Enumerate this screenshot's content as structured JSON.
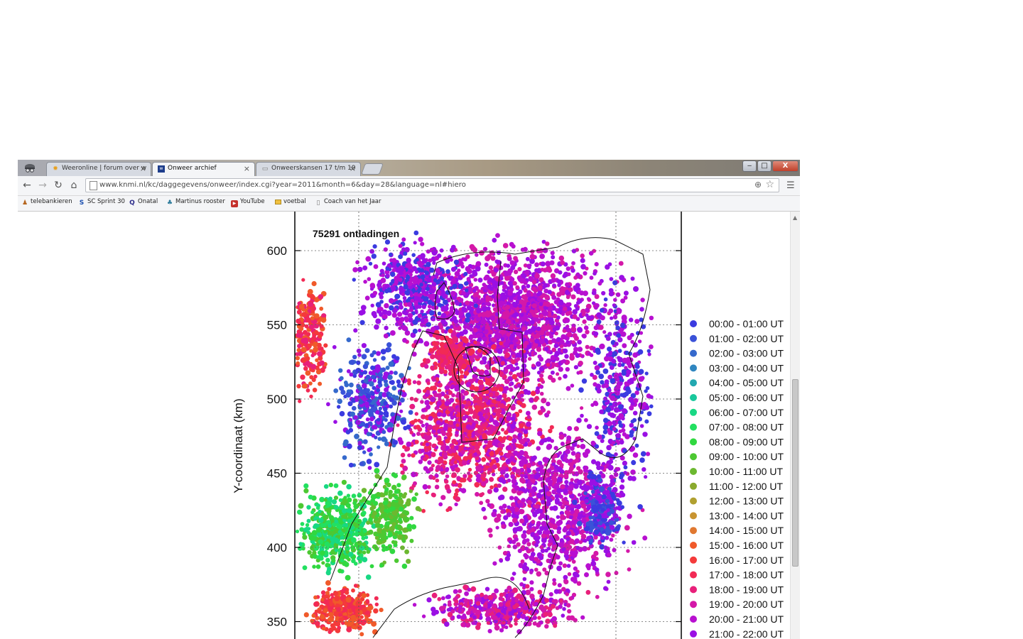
{
  "browser": {
    "tabs": [
      {
        "title": "Weeronline | forum over w",
        "icon": "forum-icon"
      },
      {
        "title": "Onweer archief",
        "icon": "knmi-icon"
      },
      {
        "title": "Onweerskansen 17 t/m 19",
        "icon": "page-icon"
      }
    ],
    "url": "www.knmi.nl/kc/daggegevens/onweer/index.cgi?year=2011&month=6&day=28&language=nl#hiero",
    "bookmarks": [
      {
        "label": "telebankieren",
        "icon": "bank-icon"
      },
      {
        "label": "SC Sprint 30",
        "icon": "sc-icon"
      },
      {
        "label": "Onatal",
        "icon": "q-icon"
      },
      {
        "label": "Martinus rooster",
        "icon": "tree-icon"
      },
      {
        "label": "YouTube",
        "icon": "youtube-icon"
      },
      {
        "label": "voetbal",
        "icon": "folder-icon"
      },
      {
        "label": "Coach van het Jaar",
        "icon": "page-icon"
      }
    ],
    "window_buttons": {
      "minimize": "‒",
      "maximize": "□",
      "close": "X"
    }
  },
  "chart_data": {
    "type": "scatter",
    "title": "75291 ontladingen",
    "ylabel": "Y-coordinaat (km)",
    "yticks": [
      350,
      400,
      450,
      500,
      550,
      600
    ],
    "ylim": [
      340,
      620
    ],
    "legend_position": "right",
    "legend": [
      {
        "label": "00:00 - 01:00 UT",
        "color": "#3b3be0"
      },
      {
        "label": "01:00 - 02:00 UT",
        "color": "#3a52d8"
      },
      {
        "label": "02:00 - 03:00 UT",
        "color": "#3569cc"
      },
      {
        "label": "03:00 - 04:00 UT",
        "color": "#2f86c0"
      },
      {
        "label": "04:00 - 05:00 UT",
        "color": "#22a8b0"
      },
      {
        "label": "05:00 - 06:00 UT",
        "color": "#18c89c"
      },
      {
        "label": "06:00 - 07:00 UT",
        "color": "#18d884"
      },
      {
        "label": "07:00 - 08:00 UT",
        "color": "#22e060"
      },
      {
        "label": "08:00 - 09:00 UT",
        "color": "#30d840"
      },
      {
        "label": "09:00 - 10:00 UT",
        "color": "#4cc832"
      },
      {
        "label": "10:00 - 11:00 UT",
        "color": "#6cb830"
      },
      {
        "label": "11:00 - 12:00 UT",
        "color": "#8aaa2e"
      },
      {
        "label": "12:00 - 13:00 UT",
        "color": "#b0a030"
      },
      {
        "label": "13:00 - 14:00 UT",
        "color": "#c89430"
      },
      {
        "label": "14:00 - 15:00 UT",
        "color": "#e07830"
      },
      {
        "label": "15:00 - 16:00 UT",
        "color": "#f05a2a"
      },
      {
        "label": "16:00 - 17:00 UT",
        "color": "#f43a3a"
      },
      {
        "label": "17:00 - 18:00 UT",
        "color": "#f22a55"
      },
      {
        "label": "18:00 - 19:00 UT",
        "color": "#e8207a"
      },
      {
        "label": "19:00 - 20:00 UT",
        "color": "#d418a8"
      },
      {
        "label": "20:00 - 21:00 UT",
        "color": "#b810d0"
      },
      {
        "label": "21:00 - 22:00 UT",
        "color": "#9a10e4"
      }
    ]
  }
}
